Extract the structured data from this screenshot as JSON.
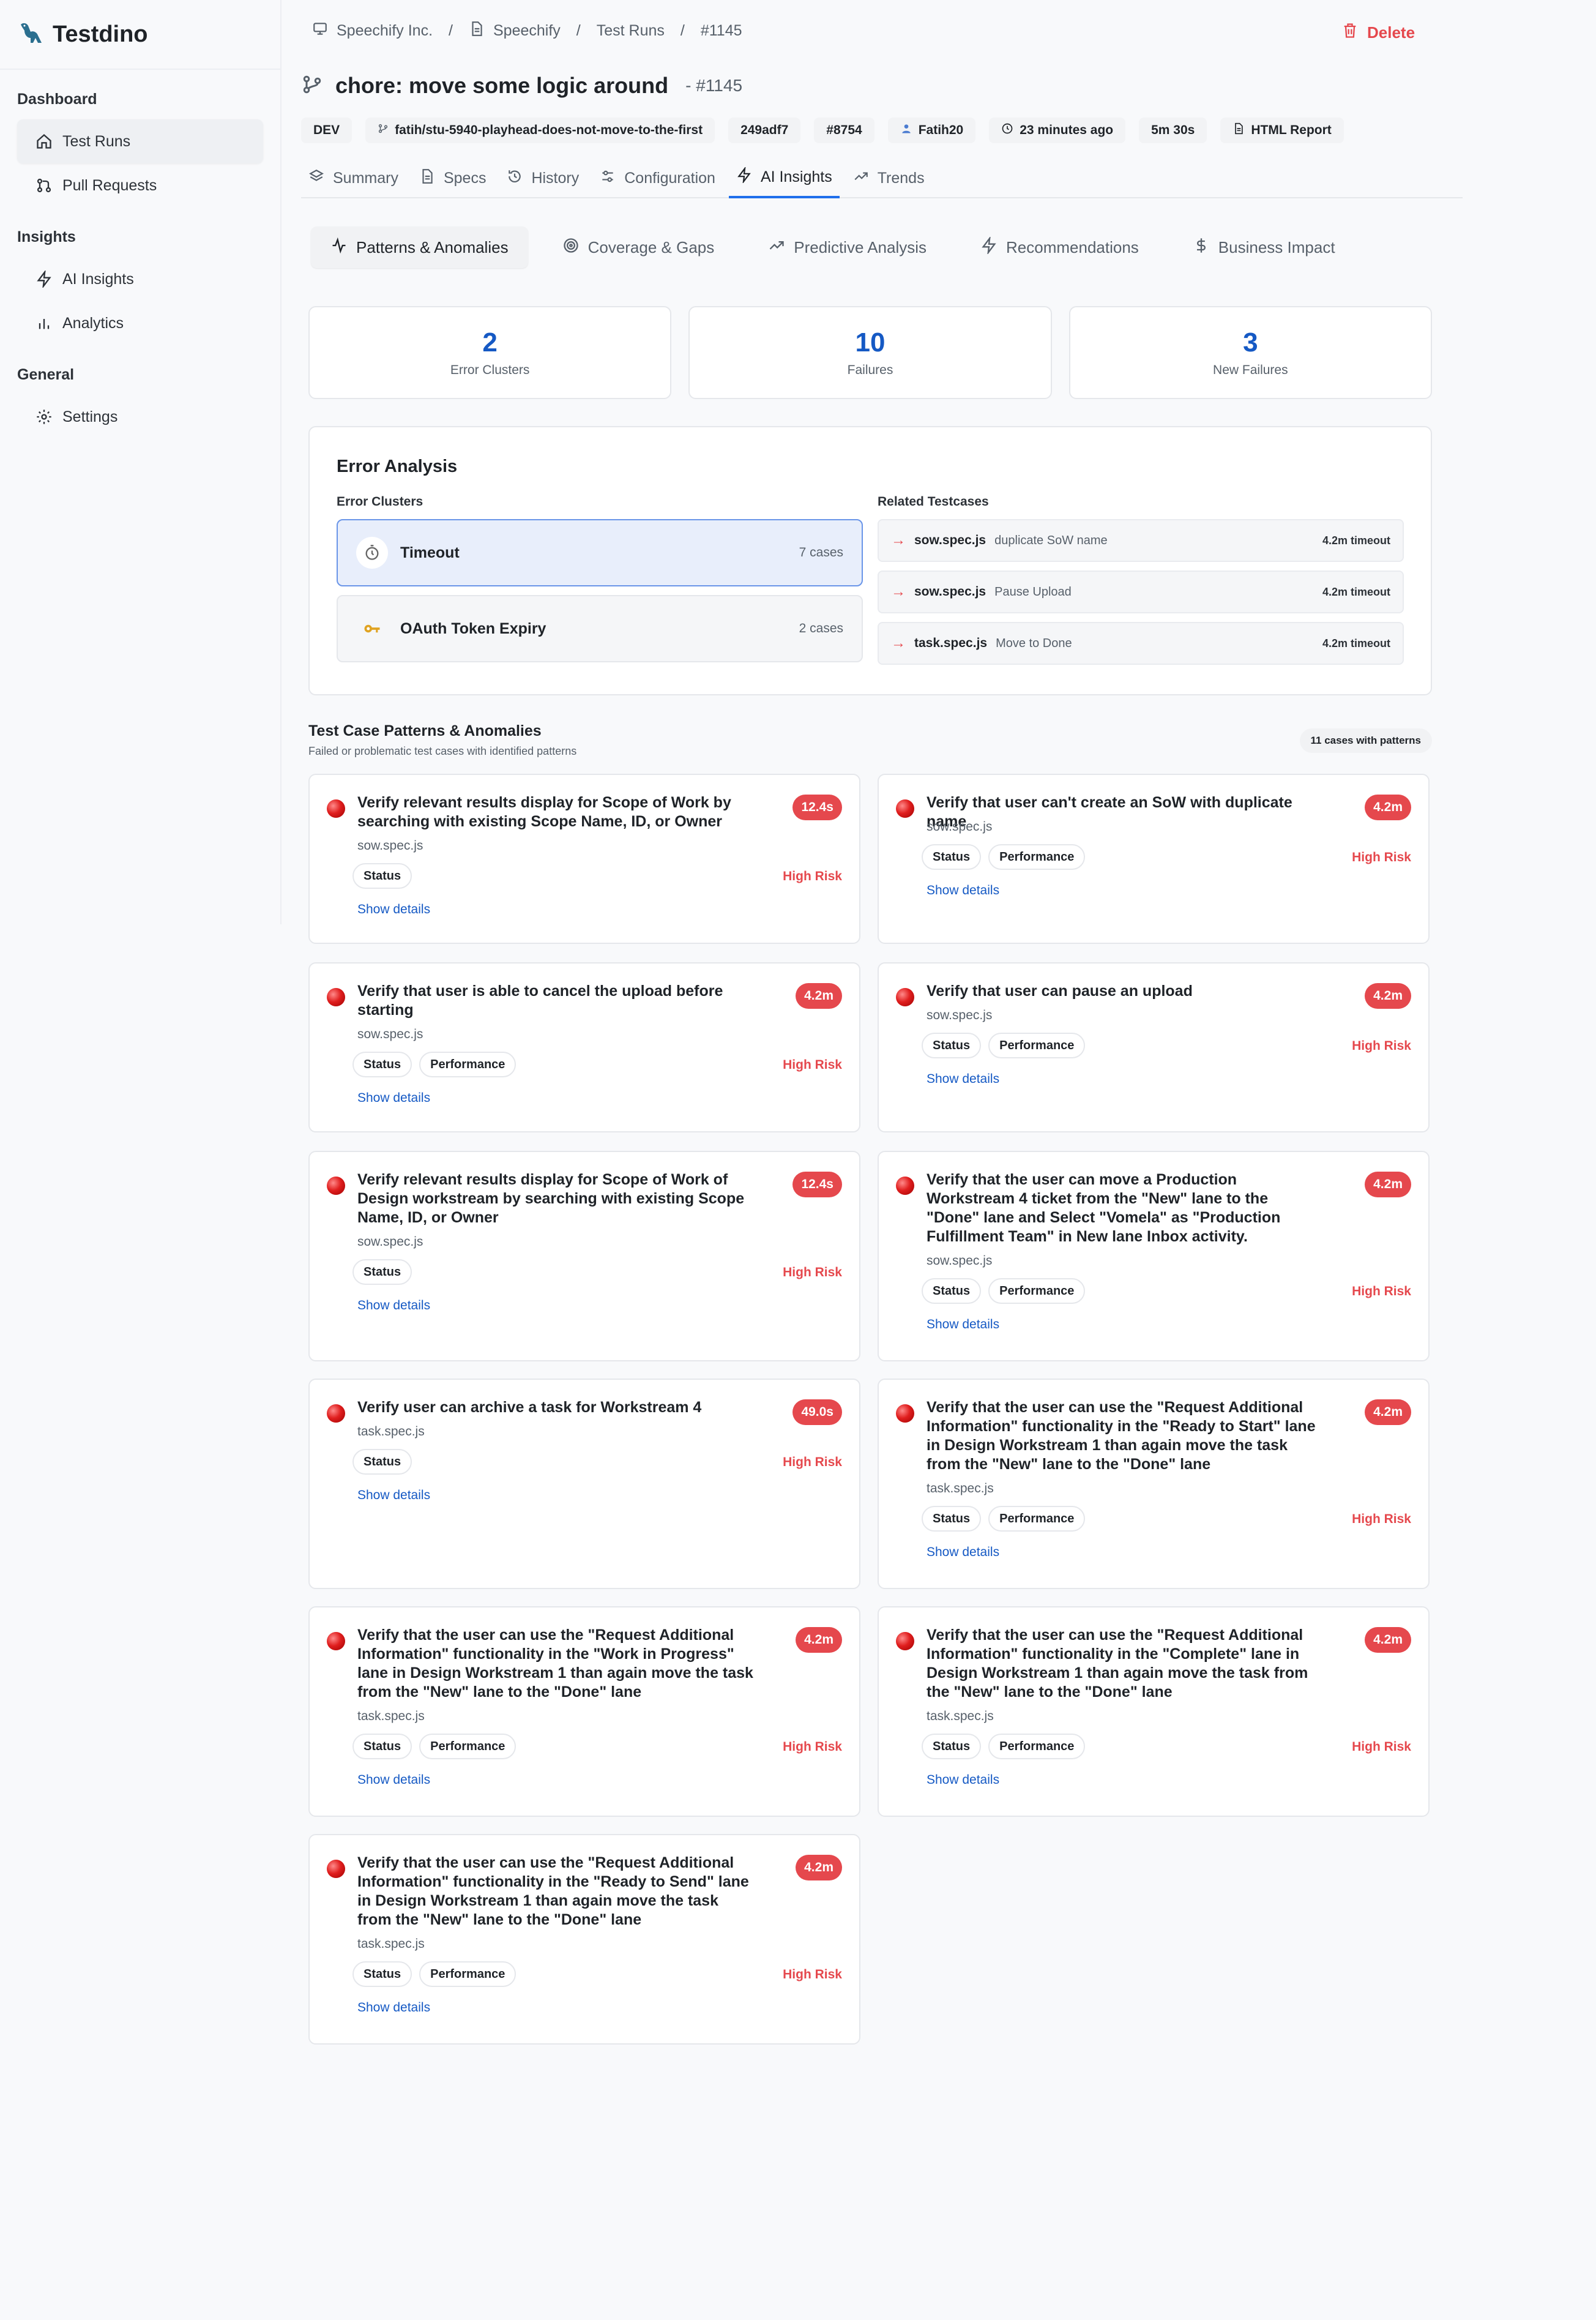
{
  "app": {
    "name": "Testdino"
  },
  "sidebar": {
    "sections": [
      {
        "heading": "Dashboard",
        "items": [
          {
            "label": "Test Runs",
            "icon": "home-icon",
            "active": true
          },
          {
            "label": "Pull Requests",
            "icon": "pull-request-icon"
          }
        ]
      },
      {
        "heading": "Insights",
        "items": [
          {
            "label": "AI Insights",
            "icon": "lightning-icon"
          },
          {
            "label": "Analytics",
            "icon": "bar-chart-icon"
          }
        ]
      },
      {
        "heading": "General",
        "items": [
          {
            "label": "Settings",
            "icon": "gear-icon"
          }
        ]
      }
    ]
  },
  "breadcrumb": {
    "org": "Speechify Inc.",
    "project": "Speechify",
    "section": "Test Runs",
    "run": "#1145"
  },
  "header": {
    "delete_label": "Delete",
    "title": "chore: move some logic around",
    "run_number": "- #1145"
  },
  "meta": {
    "env": "DEV",
    "branch": "fatih/stu-5940-playhead-does-not-move-to-the-first",
    "commit": "249adf7",
    "pr": "#8754",
    "author": "Fatih20",
    "time_ago": "23 minutes ago",
    "duration": "5m 30s",
    "report": "HTML Report"
  },
  "tabs": [
    "Summary",
    "Specs",
    "History",
    "Configuration",
    "AI Insights",
    "Trends"
  ],
  "active_tab": "AI Insights",
  "subtabs": [
    "Patterns & Anomalies",
    "Coverage & Gaps",
    "Predictive Analysis",
    "Recommendations",
    "Business Impact"
  ],
  "stats": [
    {
      "value": "2",
      "label": "Error Clusters"
    },
    {
      "value": "10",
      "label": "Failures"
    },
    {
      "value": "3",
      "label": "New Failures"
    }
  ],
  "analysis": {
    "title": "Error Analysis",
    "clusters_label": "Error Clusters",
    "related_label": "Related Testcases",
    "clusters": [
      {
        "name": "Timeout",
        "count": "7 cases",
        "icon": "stopwatch-icon"
      },
      {
        "name": "OAuth Token Expiry",
        "count": "2 cases",
        "icon": "key-icon"
      }
    ],
    "related": [
      {
        "file": "sow.spec.js",
        "name": "duplicate SoW name",
        "time": "4.2m timeout"
      },
      {
        "file": "sow.spec.js",
        "name": "Pause Upload",
        "time": "4.2m timeout"
      },
      {
        "file": "task.spec.js",
        "name": "Move to Done",
        "time": "4.2m timeout"
      }
    ]
  },
  "patterns": {
    "title": "Test Case Patterns & Anomalies",
    "subtitle": "Failed or problematic test cases with identified patterns",
    "badge": "11 cases with patterns",
    "risk_label": "High Risk",
    "link_label": "Show details",
    "cards": [
      {
        "title": "Verify relevant results display for Scope of Work by searching with existing Scope Name, ID, or Owner",
        "time": "12.4s",
        "file": "sow.spec.js",
        "tags": [
          "Status"
        ]
      },
      {
        "title": "Verify that user can't create an SoW with duplicate name",
        "time": "4.2m",
        "file": "sow.spec.js",
        "tags": [
          "Status",
          "Performance"
        ]
      },
      {
        "title": "Verify that user is able to cancel the upload before starting",
        "time": "4.2m",
        "file": "sow.spec.js",
        "tags": [
          "Status",
          "Performance"
        ]
      },
      {
        "title": "Verify that user can pause an upload",
        "time": "4.2m",
        "file": "sow.spec.js",
        "tags": [
          "Status",
          "Performance"
        ]
      },
      {
        "title": "Verify relevant results display for Scope of Work of Design workstream by searching with existing Scope Name, ID, or Owner",
        "time": "12.4s",
        "file": "sow.spec.js",
        "tags": [
          "Status"
        ]
      },
      {
        "title": "Verify that the user can move a Production Workstream 4 ticket from the \"New\" lane to the \"Done\" lane and Select \"Vomela\" as \"Production Fulfillment Team\" in New lane Inbox activity.",
        "time": "4.2m",
        "file": "sow.spec.js",
        "tags": [
          "Status",
          "Performance"
        ]
      },
      {
        "title": "Verify user can archive a task for Workstream 4",
        "time": "49.0s",
        "file": "task.spec.js",
        "tags": [
          "Status"
        ]
      },
      {
        "title": "Verify that the user can use the \"Request Additional Information\" functionality in the \"Ready to Start\" lane in Design Workstream 1 than again move the task from the \"New\" lane to the \"Done\" lane",
        "time": "4.2m",
        "file": "task.spec.js",
        "tags": [
          "Status",
          "Performance"
        ]
      },
      {
        "title": "Verify that the user can use the \"Request Additional Information\" functionality in the \"Work in Progress\" lane in Design Workstream 1 than again move the task from the \"New\" lane to the \"Done\" lane",
        "time": "4.2m",
        "file": "task.spec.js",
        "tags": [
          "Status",
          "Performance"
        ]
      },
      {
        "title": "Verify that the user can use the \"Request Additional Information\" functionality in the \"Complete\" lane in Design Workstream 1 than again move the task from the \"New\" lane to the \"Done\" lane",
        "time": "4.2m",
        "file": "task.spec.js",
        "tags": [
          "Status",
          "Performance"
        ]
      },
      {
        "title": "Verify that the user can use the \"Request Additional Information\" functionality in the \"Ready to Send\" lane in Design Workstream 1 than again move the task from the \"New\" lane to the \"Done\" lane",
        "time": "4.2m",
        "file": "task.spec.js",
        "tags": [
          "Status",
          "Performance"
        ]
      }
    ]
  }
}
